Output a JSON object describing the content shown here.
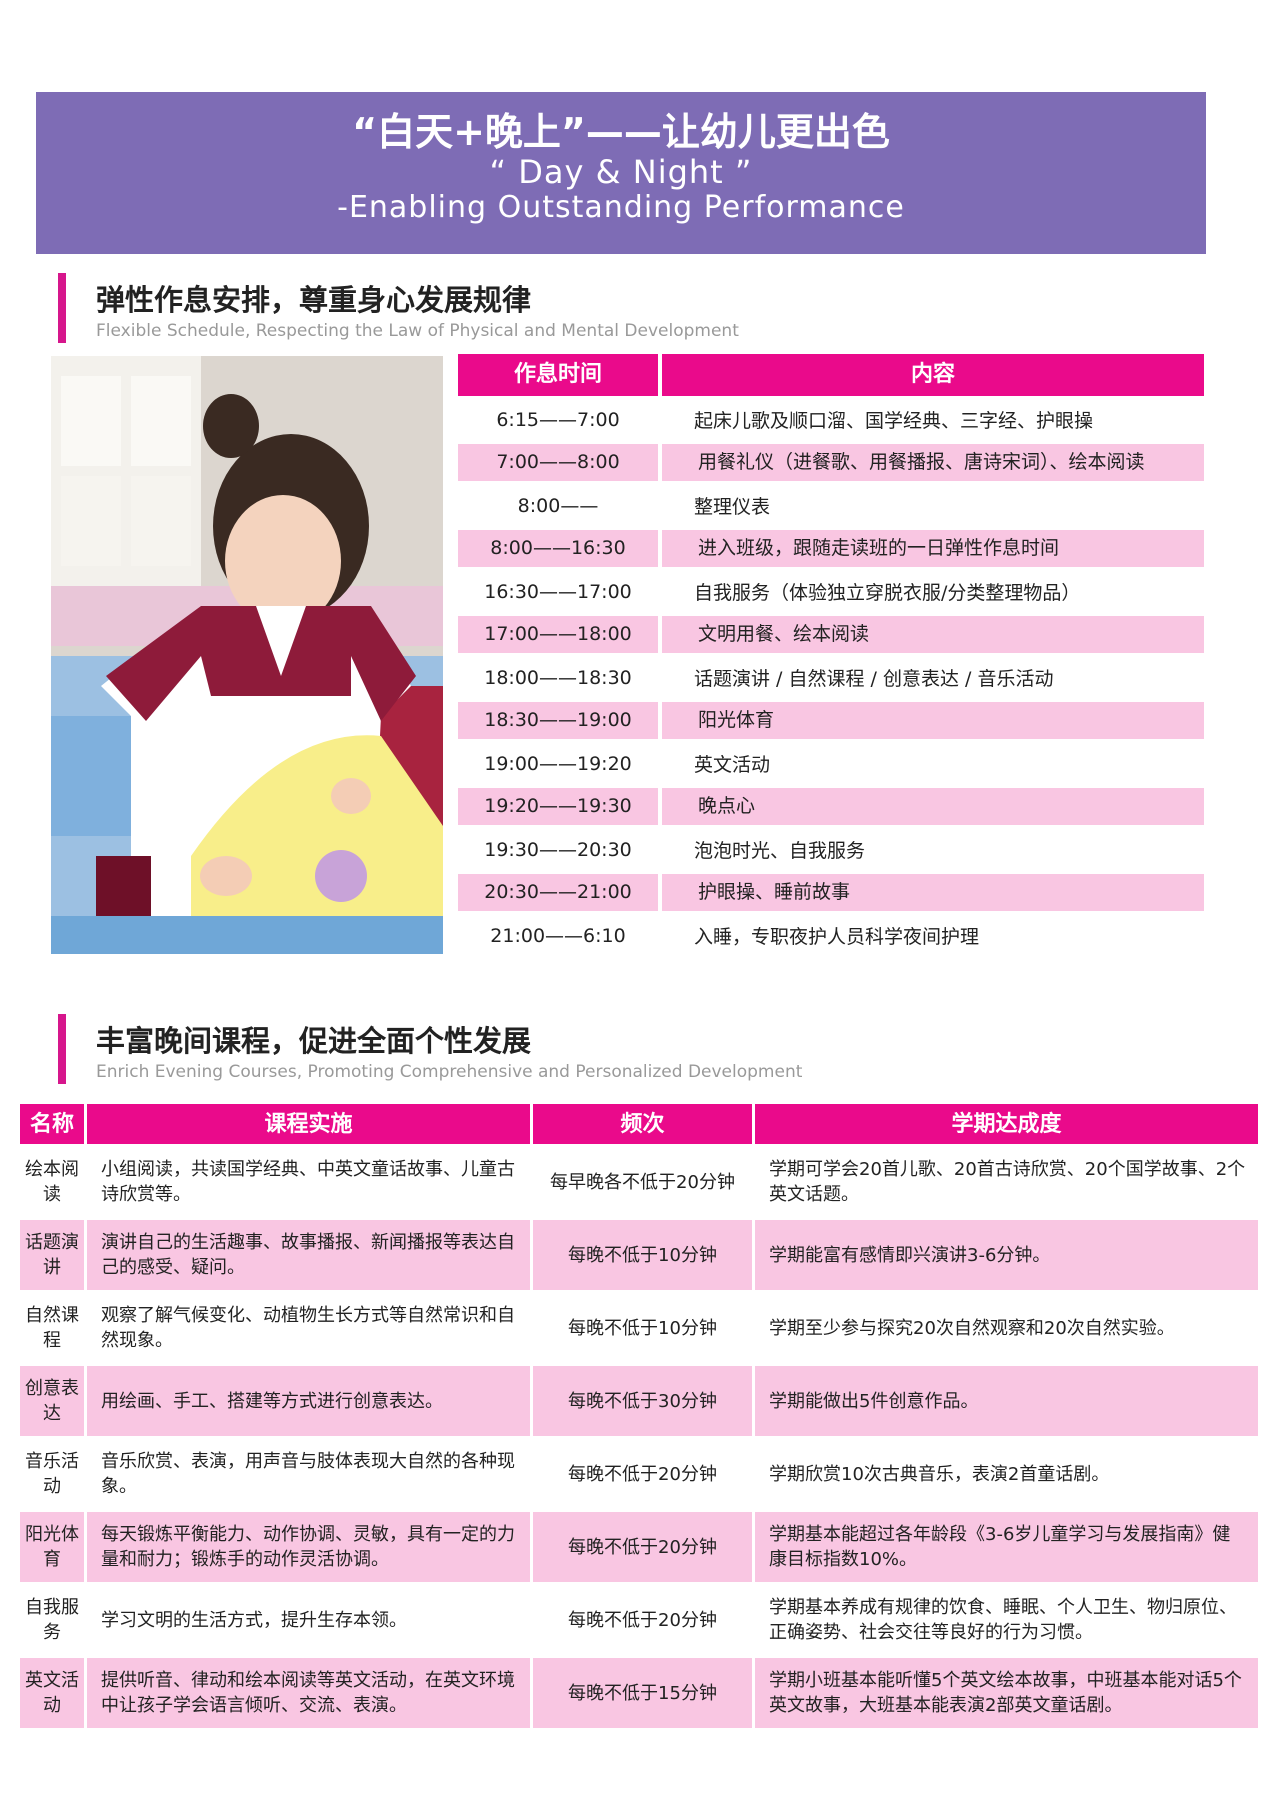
{
  "banner": {
    "title_cn": "“白天+晚上”——让幼儿更出色",
    "title_en1": "“ Day & Night ”",
    "title_en2": "-Enabling Outstanding Performance"
  },
  "section1": {
    "title": "弹性作息安排，尊重身心发展规律",
    "subtitle": "Flexible Schedule, Respecting the Law of Physical and Mental Development"
  },
  "schedule": {
    "headers": [
      "作息时间",
      "内容"
    ],
    "rows": [
      {
        "time": "6:15——7:00",
        "content": "起床儿歌及顺口溜、国学经典、三字经、护眼操"
      },
      {
        "time": "7:00——8:00",
        "content": "用餐礼仪（进餐歌、用餐播报、唐诗宋词）、绘本阅读"
      },
      {
        "time": "8:00——",
        "content": "整理仪表"
      },
      {
        "time": "8:00——16:30",
        "content": "进入班级，跟随走读班的一日弹性作息时间"
      },
      {
        "time": "16:30——17:00",
        "content": "自我服务（体验独立穿脱衣服/分类整理物品）"
      },
      {
        "time": "17:00——18:00",
        "content": "文明用餐、绘本阅读"
      },
      {
        "time": "18:00——18:30",
        "content": "话题演讲 / 自然课程 / 创意表达 / 音乐活动"
      },
      {
        "time": "18:30——19:00",
        "content": "阳光体育"
      },
      {
        "time": "19:00——19:20",
        "content": "英文活动"
      },
      {
        "time": "19:20——19:30",
        "content": "晚点心"
      },
      {
        "time": "19:30——20:30",
        "content": "泡泡时光、自我服务"
      },
      {
        "time": "20:30——21:00",
        "content": "护眼操、睡前故事"
      },
      {
        "time": "21:00——6:10",
        "content": "入睡，专职夜护人员科学夜间护理"
      }
    ]
  },
  "section2": {
    "title": "丰富晚间课程，促进全面个性发展",
    "subtitle": "Enrich Evening Courses, Promoting Comprehensive and Personalized Development"
  },
  "courses": {
    "headers": [
      "名称",
      "课程实施",
      "频次",
      "学期达成度"
    ],
    "rows": [
      {
        "name": "绘本阅读",
        "impl": "小组阅读，共读国学经典、中英文童话故事、儿童古诗欣赏等。",
        "freq": "每早晚各不低于20分钟",
        "goal": "学期可学会20首儿歌、20首古诗欣赏、20个国学故事、2个英文话题。"
      },
      {
        "name": "话题演讲",
        "impl": "演讲自己的生活趣事、故事播报、新闻播报等表达自己的感受、疑问。",
        "freq": "每晚不低于10分钟",
        "goal": "学期能富有感情即兴演讲3-6分钟。"
      },
      {
        "name": "自然课程",
        "impl": "观察了解气候变化、动植物生长方式等自然常识和自然现象。",
        "freq": "每晚不低于10分钟",
        "goal": "学期至少参与探究20次自然观察和20次自然实验。"
      },
      {
        "name": "创意表达",
        "impl": "用绘画、手工、搭建等方式进行创意表达。",
        "freq": "每晚不低于30分钟",
        "goal": "学期能做出5件创意作品。"
      },
      {
        "name": "音乐活动",
        "impl": "音乐欣赏、表演，用声音与肢体表现大自然的各种现象。",
        "freq": "每晚不低于20分钟",
        "goal": "学期欣赏10次古典音乐，表演2首童话剧。"
      },
      {
        "name": "阳光体育",
        "impl": "每天锻炼平衡能力、动作协调、灵敏，具有一定的力量和耐力；锻炼手的动作灵活协调。",
        "freq": "每晚不低于20分钟",
        "goal": "学期基本能超过各年龄段《3-6岁儿童学习与发展指南》健康目标指数10%。"
      },
      {
        "name": "自我服务",
        "impl": "学习文明的生活方式，提升生存本领。",
        "freq": "每晚不低于20分钟",
        "goal": "学期基本养成有规律的饮食、睡眠、个人卫生、物归原位、正确姿势、社会交往等良好的行为习惯。"
      },
      {
        "name": "英文活动",
        "impl": "提供听音、律动和绘本阅读等英文活动，在英文环境中让孩子学会语言倾听、交流、表演。",
        "freq": "每晚不低于15分钟",
        "goal": "学期小班基本能听懂5个英文绘本故事，中班基本能对话5个英文故事，大班基本能表演2部英文童话剧。"
      }
    ]
  }
}
